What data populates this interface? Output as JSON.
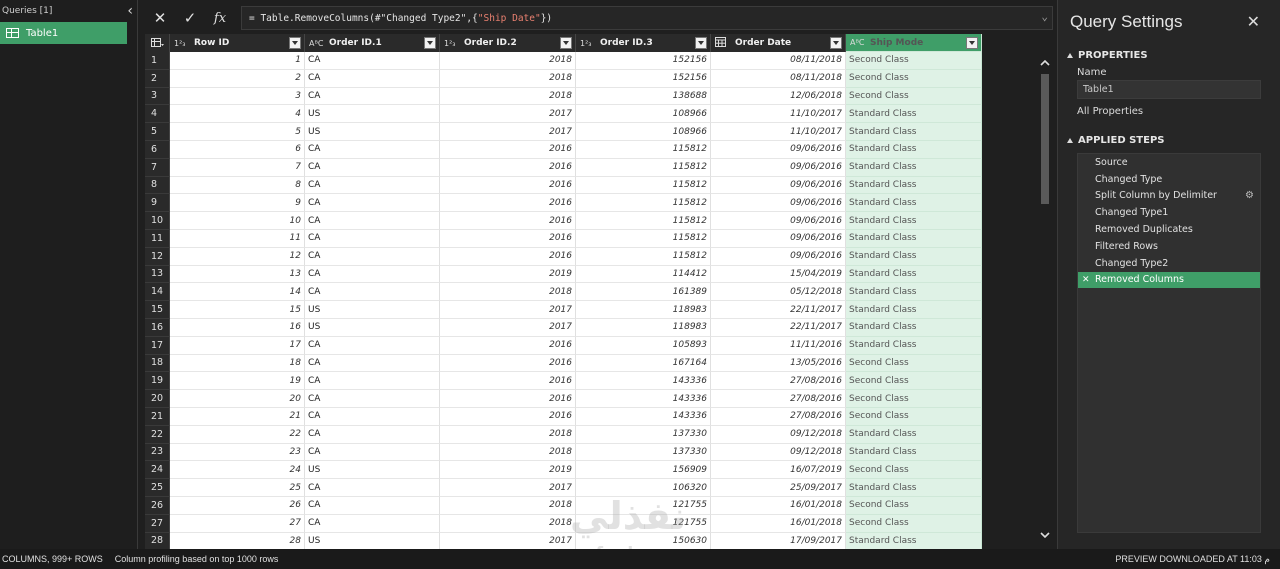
{
  "queries": {
    "header": "Queries [1]",
    "items": [
      {
        "label": "Table1"
      }
    ]
  },
  "formula": {
    "prefix": "= Table.RemoveColumns(#\"Changed Type2\",{",
    "string": "\"Ship Date\"",
    "suffix": "})"
  },
  "columns": [
    {
      "type": "1²₃",
      "label": "Row ID"
    },
    {
      "type": "A^B_C",
      "label": "Order ID.1"
    },
    {
      "type": "1²₃",
      "label": "Order ID.2"
    },
    {
      "type": "1²₃",
      "label": "Order ID.3"
    },
    {
      "type": "calendar",
      "label": "Order Date"
    },
    {
      "type": "A^B_C",
      "label": "Ship Mode"
    }
  ],
  "rows": [
    [
      "1",
      "1",
      "CA",
      "2018",
      "152156",
      "08/11/2018",
      "Second Class"
    ],
    [
      "2",
      "2",
      "CA",
      "2018",
      "152156",
      "08/11/2018",
      "Second Class"
    ],
    [
      "3",
      "3",
      "CA",
      "2018",
      "138688",
      "12/06/2018",
      "Second Class"
    ],
    [
      "4",
      "4",
      "US",
      "2017",
      "108966",
      "11/10/2017",
      "Standard Class"
    ],
    [
      "5",
      "5",
      "US",
      "2017",
      "108966",
      "11/10/2017",
      "Standard Class"
    ],
    [
      "6",
      "6",
      "CA",
      "2016",
      "115812",
      "09/06/2016",
      "Standard Class"
    ],
    [
      "7",
      "7",
      "CA",
      "2016",
      "115812",
      "09/06/2016",
      "Standard Class"
    ],
    [
      "8",
      "8",
      "CA",
      "2016",
      "115812",
      "09/06/2016",
      "Standard Class"
    ],
    [
      "9",
      "9",
      "CA",
      "2016",
      "115812",
      "09/06/2016",
      "Standard Class"
    ],
    [
      "10",
      "10",
      "CA",
      "2016",
      "115812",
      "09/06/2016",
      "Standard Class"
    ],
    [
      "11",
      "11",
      "CA",
      "2016",
      "115812",
      "09/06/2016",
      "Standard Class"
    ],
    [
      "12",
      "12",
      "CA",
      "2016",
      "115812",
      "09/06/2016",
      "Standard Class"
    ],
    [
      "13",
      "13",
      "CA",
      "2019",
      "114412",
      "15/04/2019",
      "Standard Class"
    ],
    [
      "14",
      "14",
      "CA",
      "2018",
      "161389",
      "05/12/2018",
      "Standard Class"
    ],
    [
      "15",
      "15",
      "US",
      "2017",
      "118983",
      "22/11/2017",
      "Standard Class"
    ],
    [
      "16",
      "16",
      "US",
      "2017",
      "118983",
      "22/11/2017",
      "Standard Class"
    ],
    [
      "17",
      "17",
      "CA",
      "2016",
      "105893",
      "11/11/2016",
      "Standard Class"
    ],
    [
      "18",
      "18",
      "CA",
      "2016",
      "167164",
      "13/05/2016",
      "Second Class"
    ],
    [
      "19",
      "19",
      "CA",
      "2016",
      "143336",
      "27/08/2016",
      "Second Class"
    ],
    [
      "20",
      "20",
      "CA",
      "2016",
      "143336",
      "27/08/2016",
      "Second Class"
    ],
    [
      "21",
      "21",
      "CA",
      "2016",
      "143336",
      "27/08/2016",
      "Second Class"
    ],
    [
      "22",
      "22",
      "CA",
      "2018",
      "137330",
      "09/12/2018",
      "Standard Class"
    ],
    [
      "23",
      "23",
      "CA",
      "2018",
      "137330",
      "09/12/2018",
      "Standard Class"
    ],
    [
      "24",
      "24",
      "US",
      "2019",
      "156909",
      "16/07/2019",
      "Second Class"
    ],
    [
      "25",
      "25",
      "CA",
      "2017",
      "106320",
      "25/09/2017",
      "Standard Class"
    ],
    [
      "26",
      "26",
      "CA",
      "2018",
      "121755",
      "16/01/2018",
      "Second Class"
    ],
    [
      "27",
      "27",
      "CA",
      "2018",
      "121755",
      "16/01/2018",
      "Second Class"
    ],
    [
      "28",
      "28",
      "US",
      "2017",
      "150630",
      "17/09/2017",
      "Standard Class"
    ]
  ],
  "settings": {
    "title": "Query Settings",
    "properties_header": "PROPERTIES",
    "name_label": "Name",
    "name_value": "Table1",
    "all_properties": "All Properties",
    "steps_header": "APPLIED STEPS",
    "steps": [
      {
        "label": "Source"
      },
      {
        "label": "Changed Type"
      },
      {
        "label": "Split Column by Delimiter",
        "gear": true
      },
      {
        "label": "Changed Type1"
      },
      {
        "label": "Removed Duplicates"
      },
      {
        "label": "Filtered Rows"
      },
      {
        "label": "Changed Type2"
      },
      {
        "label": "Removed Columns",
        "active": true
      }
    ]
  },
  "status": {
    "columns_rows": "COLUMNS, 999+ ROWS",
    "profiling": "Column profiling based on top 1000 rows",
    "preview": "PREVIEW DOWNLOADED AT 11:03 م"
  },
  "watermark": {
    "arabic": "نفذلي",
    "latin": "nafezly.com"
  },
  "colors": {
    "accent": "#3f9e68",
    "selected_column_bg": "#dff2e6"
  }
}
